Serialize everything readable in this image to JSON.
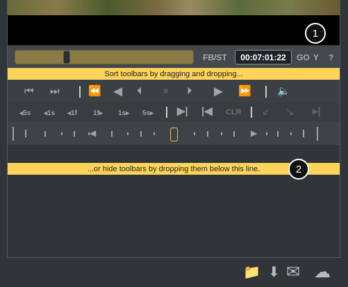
{
  "video": {
    "badge1": "1"
  },
  "scrub": {
    "fbst_label": "FB/ST",
    "timecode": "00:07:01:22",
    "go_label": "GO",
    "y_label": "Y",
    "help_label": "?"
  },
  "banners": {
    "sort": "Sort toolbars by dragging and dropping...",
    "hide": "...or hide toolbars by dropping them below this line.",
    "badge2": "2"
  },
  "step_toolbar": {
    "steps": [
      "◂5s",
      "◂1s",
      "◂1f",
      "1f▸",
      "1s▸",
      "5s▸"
    ],
    "clr_label": "CLR"
  },
  "icons": {
    "first_frame": "⏮",
    "last_frame": "⏭",
    "rewind": "⏪",
    "play_reverse": "◀",
    "step_back": "⏴",
    "pause": "⏸",
    "step_forward": "⏵",
    "play": "▶",
    "fast_forward": "⏩",
    "volume": "🔈",
    "mark_out": "▶|",
    "mark_in": "|◀",
    "import_in": "↙",
    "import_out": "↘",
    "end_mark": "▸|",
    "add_folder": "📁",
    "download": "⬇",
    "mail": "✉",
    "cloud_upload": "☁"
  }
}
